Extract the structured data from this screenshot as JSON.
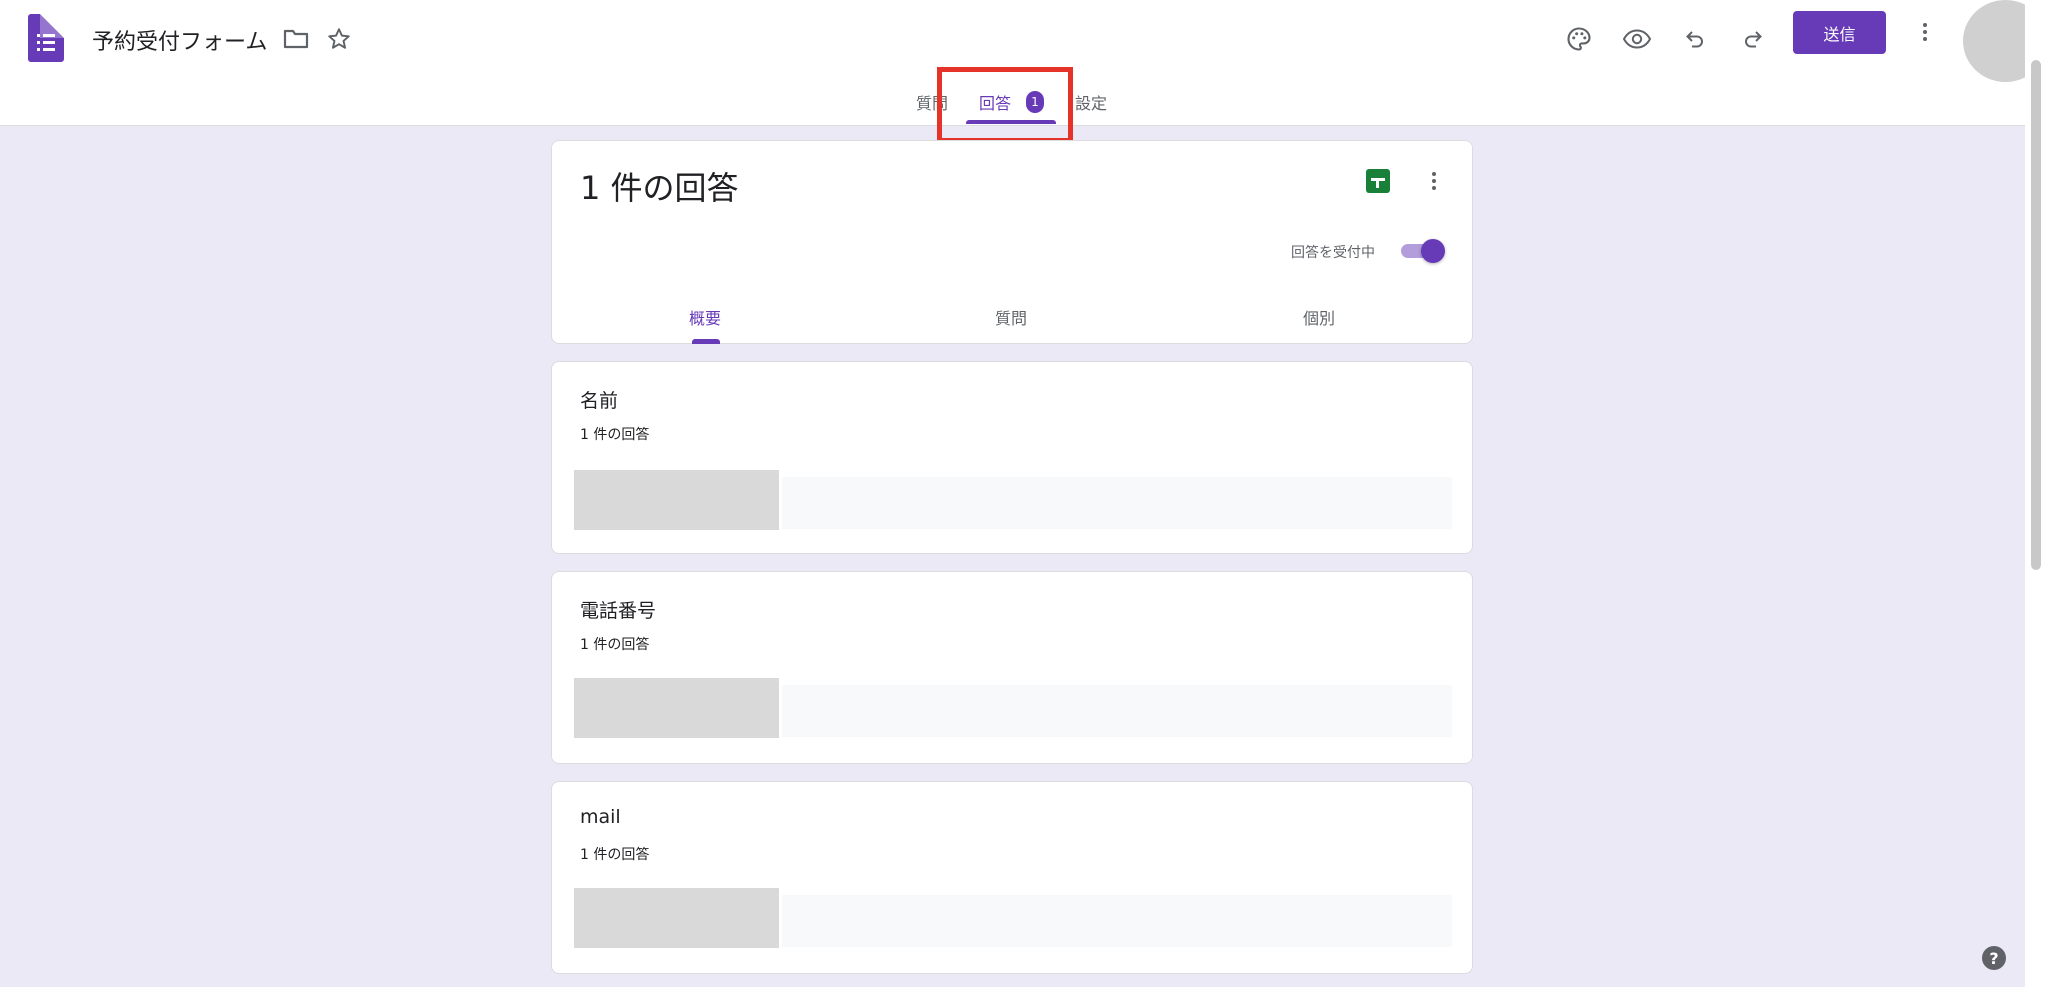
{
  "header": {
    "doc_title": "予約受付フォーム",
    "send_label": "送信",
    "icons": [
      "folder-icon",
      "star-icon",
      "palette-icon",
      "preview-icon",
      "undo-icon",
      "redo-icon",
      "more-vert-icon"
    ]
  },
  "top_tabs": [
    {
      "label": "質問",
      "active": false
    },
    {
      "label": "回答",
      "active": true,
      "badge": "1"
    },
    {
      "label": "設定",
      "active": false
    }
  ],
  "summary": {
    "title": "1 件の回答",
    "accepting_label": "回答を受付中",
    "accepting": true,
    "tabs": [
      {
        "label": "概要",
        "active": true
      },
      {
        "label": "質問",
        "active": false
      },
      {
        "label": "個別",
        "active": false
      }
    ]
  },
  "questions": [
    {
      "title": "名前",
      "count": "1 件の回答"
    },
    {
      "title": "電話番号",
      "count": "1 件の回答"
    },
    {
      "title": "mail",
      "count": "1 件の回答"
    }
  ],
  "colors": {
    "accent": "#673ab7",
    "background": "#ece9f7",
    "highlight": "#e63329",
    "sheets": "#188038"
  }
}
